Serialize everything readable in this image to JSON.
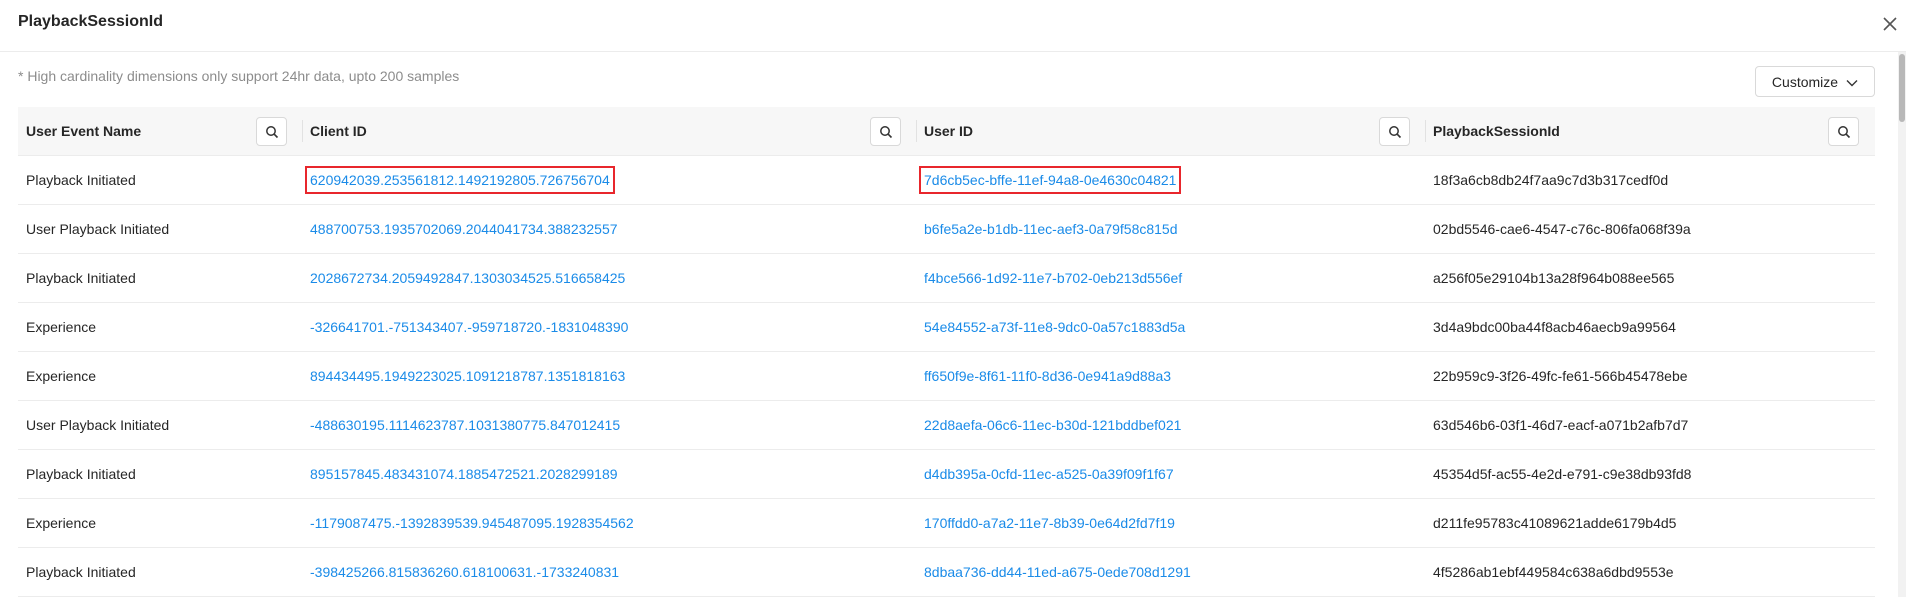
{
  "dialog": {
    "title": "PlaybackSessionId",
    "note": "* High cardinality dimensions only support 24hr data, upto 200 samples",
    "customize_label": "Customize"
  },
  "columns": [
    {
      "label": "User Event Name",
      "icon": "search-icon"
    },
    {
      "label": "Client ID",
      "icon": "search-icon"
    },
    {
      "label": "User ID",
      "icon": "search-icon"
    },
    {
      "label": "PlaybackSessionId",
      "icon": "search-icon"
    }
  ],
  "rows": [
    {
      "event": "Playback Initiated",
      "client_id": "620942039.253561812.1492192805.726756704",
      "user_id": "7d6cb5ec-bffe-11ef-94a8-0e4630c04821",
      "session_id": "18f3a6cb8db24f7aa9c7d3b317cedf0d"
    },
    {
      "event": "User Playback Initiated",
      "client_id": "488700753.1935702069.2044041734.388232557",
      "user_id": "b6fe5a2e-b1db-11ec-aef3-0a79f58c815d",
      "session_id": "02bd5546-cae6-4547-c76c-806fa068f39a"
    },
    {
      "event": "Playback Initiated",
      "client_id": "2028672734.2059492847.1303034525.516658425",
      "user_id": "f4bce566-1d92-11e7-b702-0eb213d556ef",
      "session_id": "a256f05e29104b13a28f964b088ee565"
    },
    {
      "event": "Experience",
      "client_id": "-326641701.-751343407.-959718720.-1831048390",
      "user_id": "54e84552-a73f-11e8-9dc0-0a57c1883d5a",
      "session_id": "3d4a9bdc00ba44f8acb46aecb9a99564"
    },
    {
      "event": "Experience",
      "client_id": "894434495.1949223025.1091218787.1351818163",
      "user_id": "ff650f9e-8f61-11f0-8d36-0e941a9d88a3",
      "session_id": "22b959c9-3f26-49fc-fe61-566b45478ebe"
    },
    {
      "event": "User Playback Initiated",
      "client_id": "-488630195.1114623787.1031380775.847012415",
      "user_id": "22d8aefa-06c6-11ec-b30d-121bddbef021",
      "session_id": "63d546b6-03f1-46d7-eacf-a071b2afb7d7"
    },
    {
      "event": "Playback Initiated",
      "client_id": "895157845.483431074.1885472521.2028299189",
      "user_id": "d4db395a-0cfd-11ec-a525-0a39f09f1f67",
      "session_id": "45354d5f-ac55-4e2d-e791-c9e38db93fd8"
    },
    {
      "event": "Experience",
      "client_id": "-1179087475.-1392839539.945487095.1928354562",
      "user_id": "170ffdd0-a7a2-11e7-8b39-0e64d2fd7f19",
      "session_id": "d211fe95783c41089621adde6179b4d5"
    },
    {
      "event": "Playback Initiated",
      "client_id": "-398425266.815836260.618100631.-1733240831",
      "user_id": "8dbaa736-dd44-11ed-a675-0ede708d1291",
      "session_id": "4f5286ab1ebf449584c638a6dbd9553e"
    }
  ],
  "colors": {
    "link": "#1a8be8",
    "highlight": "#e8262c",
    "header_bg": "#f7f7f7"
  }
}
